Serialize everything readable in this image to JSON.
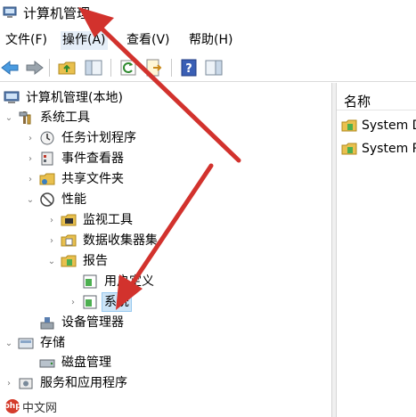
{
  "window": {
    "title": "计算机管理"
  },
  "menu": [
    {
      "label": "文件(F)",
      "active": false
    },
    {
      "label": "操作(A)",
      "active": true
    },
    {
      "label": "查看(V)",
      "active": false
    },
    {
      "label": "帮助(H)",
      "active": false
    }
  ],
  "tree": {
    "root": "计算机管理(本地)",
    "system_tools": "系统工具",
    "task_scheduler": "任务计划程序",
    "event_viewer": "事件查看器",
    "shared_folders": "共享文件夹",
    "performance": "性能",
    "monitoring_tools": "监视工具",
    "data_collector_sets": "数据收集器集",
    "reports": "报告",
    "user_defined": "用户定义",
    "system": "系统",
    "device_manager": "设备管理器",
    "storage": "存储",
    "disk_management": "磁盘管理",
    "services_apps": "服务和应用程序"
  },
  "list": {
    "column_name": "名称",
    "items": [
      "System D",
      "System P"
    ]
  },
  "watermark": {
    "badge": "php",
    "text": "中文网"
  },
  "colors": {
    "arrow": "#d2322d",
    "selection": "#cce4f7"
  }
}
